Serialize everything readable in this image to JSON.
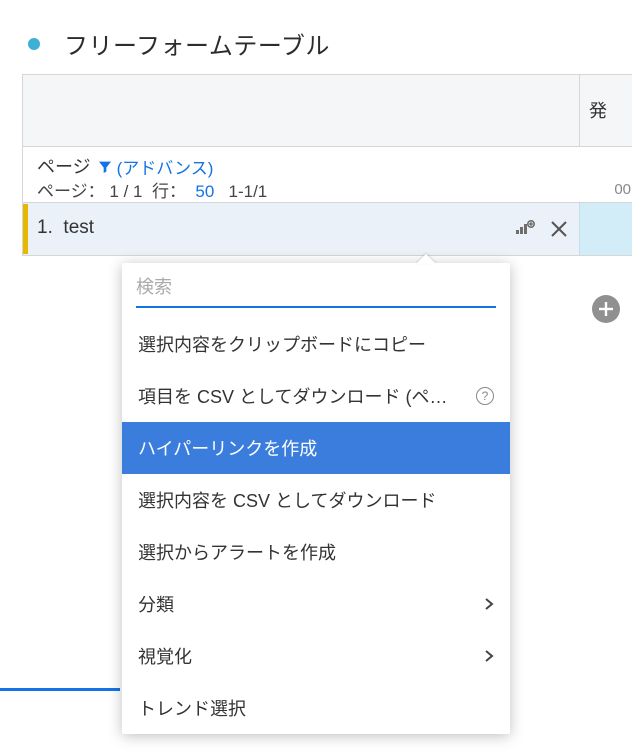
{
  "title": "フリーフォームテーブル",
  "header": {
    "right_label": "発"
  },
  "dimension": {
    "name": "ページ",
    "advance": "(アドバンス)",
    "pager_prefix": "ページ：",
    "pager_page": "1 / 1",
    "pager_rows_label": "行：",
    "pager_rows_value": "50",
    "pager_range": "1-1/1",
    "right_small": "00"
  },
  "row": {
    "index": "1.",
    "value": "test"
  },
  "menu": {
    "search_placeholder": "検索",
    "items": [
      {
        "label": "選択内容をクリップボードにコピー",
        "info": false,
        "sub": false,
        "hl": false
      },
      {
        "label": "項目を CSV としてダウンロード (ペ…",
        "info": true,
        "sub": false,
        "hl": false
      },
      {
        "label": "ハイパーリンクを作成",
        "info": false,
        "sub": false,
        "hl": true
      },
      {
        "label": "選択内容を CSV としてダウンロード",
        "info": false,
        "sub": false,
        "hl": false
      },
      {
        "label": "選択からアラートを作成",
        "info": false,
        "sub": false,
        "hl": false
      },
      {
        "label": "分類",
        "info": false,
        "sub": true,
        "hl": false
      },
      {
        "label": "視覚化",
        "info": false,
        "sub": true,
        "hl": false
      },
      {
        "label": "トレンド選択",
        "info": false,
        "sub": false,
        "hl": false
      }
    ]
  }
}
